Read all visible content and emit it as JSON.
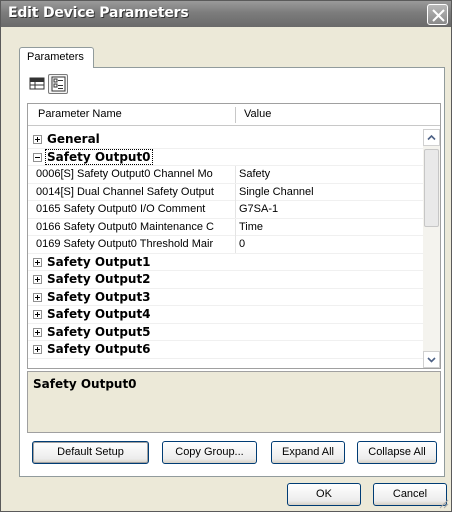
{
  "window": {
    "title": "Edit Device Parameters"
  },
  "tabs": [
    {
      "label": "Parameters"
    }
  ],
  "toolbar": {
    "icons": [
      "grid-view-icon",
      "category-view-icon"
    ]
  },
  "grid": {
    "columns": [
      "Parameter Name",
      "Value"
    ],
    "rows": [
      {
        "type": "group",
        "expanded": false,
        "label": "General"
      },
      {
        "type": "group",
        "expanded": true,
        "label": "Safety Output0"
      },
      {
        "type": "param",
        "name": "0006[S] Safety Output0 Channel Mo",
        "value": "Safety"
      },
      {
        "type": "param",
        "name": "0014[S] Dual Channel Safety Output",
        "value": "Single Channel"
      },
      {
        "type": "param",
        "name": "0165 Safety Output0 I/O Comment",
        "value": "G7SA-1"
      },
      {
        "type": "param",
        "name": "0166 Safety Output0 Maintenance C",
        "value": "Time"
      },
      {
        "type": "param",
        "name": "0169 Safety Output0 Threshold Mair",
        "value": "0"
      },
      {
        "type": "group",
        "expanded": false,
        "label": "Safety Output1"
      },
      {
        "type": "group",
        "expanded": false,
        "label": "Safety Output2"
      },
      {
        "type": "group",
        "expanded": false,
        "label": "Safety Output3"
      },
      {
        "type": "group",
        "expanded": false,
        "label": "Safety Output4"
      },
      {
        "type": "group",
        "expanded": false,
        "label": "Safety Output5"
      },
      {
        "type": "group",
        "expanded": false,
        "label": "Safety Output6"
      }
    ]
  },
  "description": {
    "text": "Safety Output0"
  },
  "actions": {
    "default_setup": "Default Setup",
    "copy_group": "Copy Group...",
    "expand_all": "Expand All",
    "collapse_all": "Collapse All"
  },
  "dialog": {
    "ok": "OK",
    "cancel": "Cancel"
  },
  "colors": {
    "titlebar": "#7c7c7c",
    "dialog_bg": "#ece9d8",
    "button_border": "#003c74"
  }
}
